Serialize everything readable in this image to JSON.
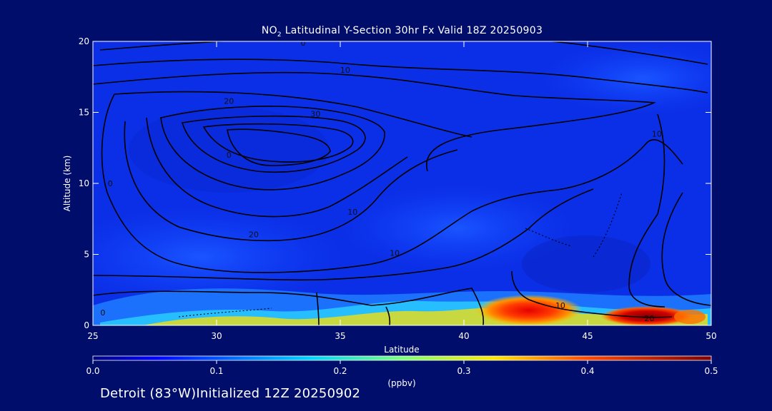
{
  "chart_data": {
    "type": "heatmap",
    "title_prefix": "NO",
    "title_subscript": "2",
    "title_suffix": " Latitudinal Y-Section 30hr  Fx Valid 18Z 20250903",
    "xlabel": "Latitude",
    "ylabel": "Altitude (km)",
    "xlim": [
      25,
      50
    ],
    "ylim": [
      0,
      20
    ],
    "x_ticks": [
      "25",
      "30",
      "35",
      "40",
      "45",
      "50"
    ],
    "y_ticks": [
      "0",
      "5",
      "10",
      "15",
      "20"
    ],
    "colorbar": {
      "label": "(ppbv)",
      "range": [
        0.0,
        0.5
      ],
      "ticks": [
        "0.0",
        "0.1",
        "0.2",
        "0.3",
        "0.4",
        "0.5"
      ]
    },
    "surface_values": [
      {
        "lat": 25,
        "value": 0.08
      },
      {
        "lat": 27,
        "value": 0.12
      },
      {
        "lat": 29,
        "value": 0.15
      },
      {
        "lat": 31,
        "value": 0.19
      },
      {
        "lat": 33,
        "value": 0.22
      },
      {
        "lat": 35,
        "value": 0.2
      },
      {
        "lat": 37,
        "value": 0.24
      },
      {
        "lat": 39,
        "value": 0.3
      },
      {
        "lat": 40,
        "value": 0.31
      },
      {
        "lat": 41,
        "value": 0.36
      },
      {
        "lat": 42,
        "value": 0.45
      },
      {
        "lat": 43,
        "value": 0.42
      },
      {
        "lat": 45,
        "value": 0.33
      },
      {
        "lat": 47,
        "value": 0.45
      },
      {
        "lat": 48,
        "value": 0.49
      },
      {
        "lat": 49,
        "value": 0.32
      },
      {
        "lat": 50,
        "value": 0.15
      }
    ],
    "contour_labels": [
      {
        "text": "0",
        "lat": 33.5,
        "alt": 19.9
      },
      {
        "text": "10",
        "lat": 35.2,
        "alt": 18.0
      },
      {
        "text": "20",
        "lat": 30.5,
        "alt": 15.8
      },
      {
        "text": "30",
        "lat": 34.0,
        "alt": 14.9
      },
      {
        "text": "0",
        "lat": 30.5,
        "alt": 12.0
      },
      {
        "text": "0",
        "lat": 25.7,
        "alt": 10.0
      },
      {
        "text": "20",
        "lat": 31.5,
        "alt": 6.4
      },
      {
        "text": "10",
        "lat": 35.5,
        "alt": 8.0
      },
      {
        "text": "10",
        "lat": 37.2,
        "alt": 5.1
      },
      {
        "text": "10",
        "lat": 47.8,
        "alt": 13.5
      },
      {
        "text": "10",
        "lat": 43.9,
        "alt": 1.4
      },
      {
        "text": "0",
        "lat": 25.4,
        "alt": 0.9
      },
      {
        "text": "20",
        "lat": 47.5,
        "alt": 0.5
      }
    ]
  },
  "footer": "Detroit (83°W)Initialized 12Z 20250902"
}
